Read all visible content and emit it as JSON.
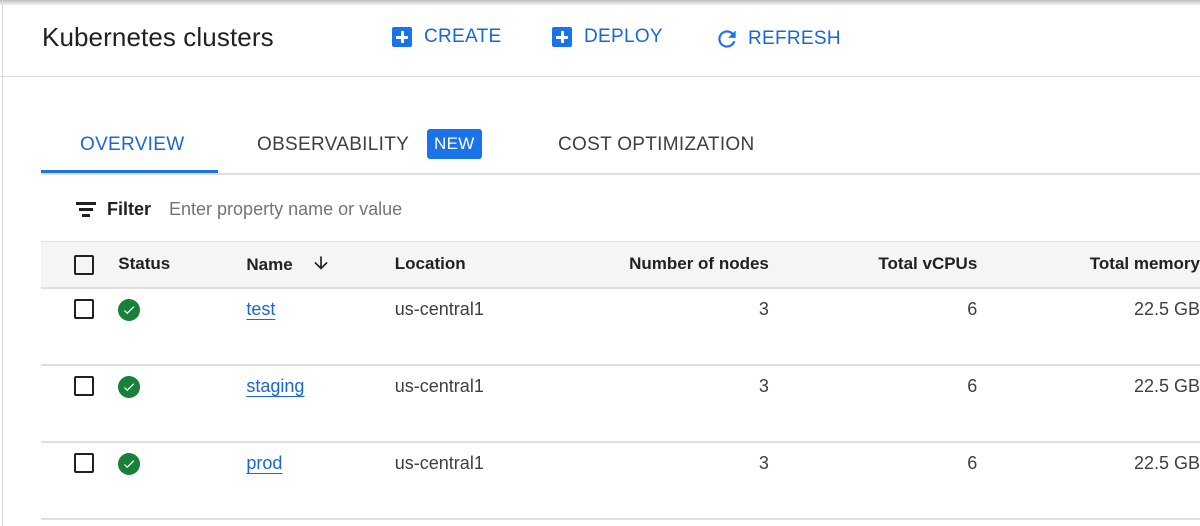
{
  "header": {
    "title": "Kubernetes clusters",
    "actions": [
      {
        "label": "CREATE",
        "icon": "add-box-icon"
      },
      {
        "label": "DEPLOY",
        "icon": "add-box-icon"
      },
      {
        "label": "REFRESH",
        "icon": "refresh-icon"
      }
    ]
  },
  "tabs": [
    {
      "label": "OVERVIEW",
      "active": true
    },
    {
      "label": "OBSERVABILITY",
      "badge": "NEW"
    },
    {
      "label": "COST OPTIMIZATION"
    }
  ],
  "filter": {
    "label": "Filter",
    "placeholder": "Enter property name or value",
    "value": ""
  },
  "table": {
    "columns": [
      "Status",
      "Name",
      "Location",
      "Number of nodes",
      "Total vCPUs",
      "Total memory"
    ],
    "sort": {
      "column": "Name",
      "direction": "descending",
      "icon": "arrow-down-icon"
    },
    "rows": [
      {
        "status": "ok",
        "name": "test",
        "location": "us-central1",
        "nodes": "3",
        "vcpus": "6",
        "memory": "22.5 GB"
      },
      {
        "status": "ok",
        "name": "staging",
        "location": "us-central1",
        "nodes": "3",
        "vcpus": "6",
        "memory": "22.5 GB"
      },
      {
        "status": "ok",
        "name": "prod",
        "location": "us-central1",
        "nodes": "3",
        "vcpus": "6",
        "memory": "22.5 GB"
      }
    ]
  },
  "colors": {
    "accent": "#1a73e8",
    "status_ok": "#188038",
    "header_bg": "#f5f5f5"
  }
}
